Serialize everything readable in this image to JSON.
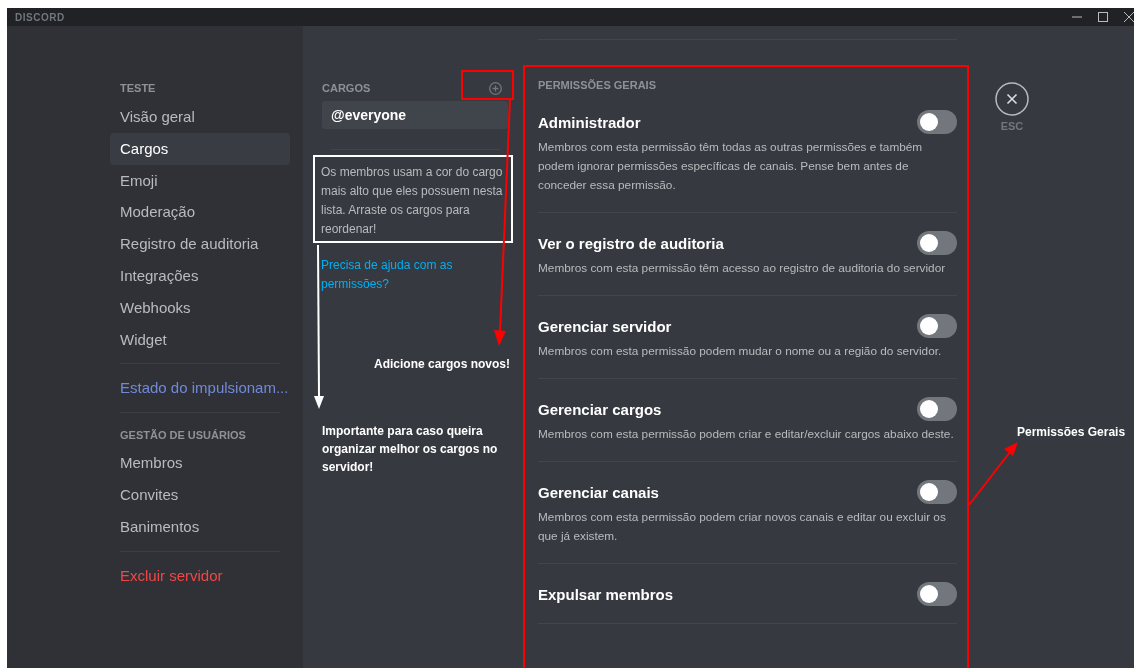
{
  "window": {
    "title": "DISCORD"
  },
  "sidebar": {
    "sections": [
      {
        "header": "TESTE",
        "items": [
          {
            "label": "Visão geral",
            "kind": "normal",
            "selected": false
          },
          {
            "label": "Cargos",
            "kind": "normal",
            "selected": true
          },
          {
            "label": "Emoji",
            "kind": "normal",
            "selected": false
          },
          {
            "label": "Moderação",
            "kind": "normal",
            "selected": false
          },
          {
            "label": "Registro de auditoria",
            "kind": "normal",
            "selected": false
          },
          {
            "label": "Integrações",
            "kind": "normal",
            "selected": false
          },
          {
            "label": "Webhooks",
            "kind": "normal",
            "selected": false
          },
          {
            "label": "Widget",
            "kind": "normal",
            "selected": false
          }
        ]
      },
      {
        "items": [
          {
            "label": "Estado do impulsionam...",
            "kind": "boost",
            "selected": false
          }
        ]
      },
      {
        "header": "GESTÃO DE USUÁRIOS",
        "items": [
          {
            "label": "Membros",
            "kind": "normal",
            "selected": false
          },
          {
            "label": "Convites",
            "kind": "normal",
            "selected": false
          },
          {
            "label": "Banimentos",
            "kind": "normal",
            "selected": false
          }
        ]
      },
      {
        "items": [
          {
            "label": "Excluir servidor",
            "kind": "danger",
            "selected": false
          }
        ]
      }
    ]
  },
  "roles": {
    "header": "CARGOS",
    "items": [
      {
        "name": "@everyone",
        "selected": true
      }
    ],
    "help_text": "Os membros usam a cor do cargo mais alto que eles possuem nesta lista. Arraste os cargos para reordenar!",
    "help_link": "Precisa de ajuda com as permissões?"
  },
  "permissions": {
    "header": "PERMISSÕES GERAIS",
    "items": [
      {
        "title": "Administrador",
        "description": "Membros com esta permissão têm todas as outras permissões e também podem ignorar permissões específicas de canais. Pense bem antes de conceder essa permissão.",
        "on": false
      },
      {
        "title": "Ver o registro de auditoria",
        "description": "Membros com esta permissão têm acesso ao registro de auditoria do servidor",
        "on": false
      },
      {
        "title": "Gerenciar servidor",
        "description": "Membros com esta permissão podem mudar o nome ou a região do servidor.",
        "on": false
      },
      {
        "title": "Gerenciar cargos",
        "description": "Membros com esta permissão podem criar e editar/excluir cargos abaixo deste.",
        "on": false
      },
      {
        "title": "Gerenciar canais",
        "description": "Membros com esta permissão podem criar novos canais e editar ou excluir os que já existem.",
        "on": false
      },
      {
        "title": "Expulsar membros",
        "on": false
      }
    ]
  },
  "close": {
    "label": "ESC"
  },
  "annotations": {
    "add_roles_note": "Adicione cargos novos!",
    "order_note": "Importante para caso queira organizar melhor os cargos no servidor!",
    "permissions_note": "Permissões Gerais"
  }
}
